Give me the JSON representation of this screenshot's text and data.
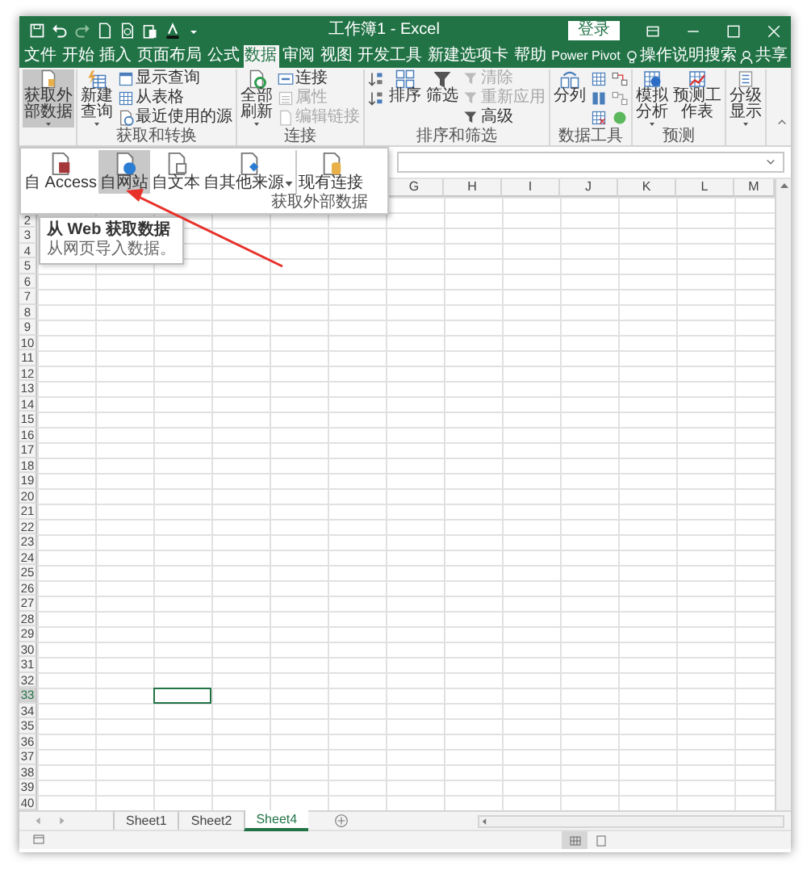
{
  "window": {
    "title": "工作簿1 - Excel"
  },
  "sign_in_button": "登录",
  "tabs": [
    {
      "label": "文件",
      "selected": false
    },
    {
      "label": "开始",
      "selected": false
    },
    {
      "label": "插入",
      "selected": false
    },
    {
      "label": "页面布局",
      "selected": false
    },
    {
      "label": "公式",
      "selected": false
    },
    {
      "label": "数据",
      "selected": true
    },
    {
      "label": "审阅",
      "selected": false
    },
    {
      "label": "视图",
      "selected": false
    },
    {
      "label": "开发工具",
      "selected": false
    },
    {
      "label": "新建选项卡",
      "selected": false
    },
    {
      "label": "帮助",
      "selected": false
    },
    {
      "label": "Power Pivot",
      "selected": false
    }
  ],
  "tell_me": "操作说明搜索",
  "share": "共享",
  "ribbon_groups": [
    {
      "items": [
        {
          "kind": "large",
          "label": "获取外部数据",
          "dropdown": true,
          "pressed": true
        }
      ]
    },
    {
      "label": "获取和转换",
      "items": [
        {
          "kind": "large",
          "label": "新建查询",
          "dropdown": true,
          "pressed": false
        },
        {
          "kind": "small",
          "label": "显示查询",
          "disabled": false
        },
        {
          "kind": "small",
          "label": "从表格",
          "disabled": false
        },
        {
          "kind": "small",
          "label": "最近使用的源",
          "disabled": false
        }
      ]
    },
    {
      "label": "连接",
      "items": [
        {
          "kind": "large",
          "label": "全部刷新",
          "dropdown": true,
          "pressed": false
        },
        {
          "kind": "small",
          "label": "连接",
          "disabled": false
        },
        {
          "kind": "small",
          "label": "属性",
          "disabled": true
        },
        {
          "kind": "small",
          "label": "编辑链接",
          "disabled": true
        }
      ]
    },
    {
      "label": "排序和筛选",
      "items": [
        {
          "kind": "icon"
        },
        {
          "kind": "icon"
        },
        {
          "kind": "large",
          "label": "排序",
          "dropdown": false,
          "pressed": false
        },
        {
          "kind": "large",
          "label": "筛选",
          "dropdown": false,
          "pressed": false
        },
        {
          "kind": "small",
          "label": "清除",
          "disabled": true
        },
        {
          "kind": "small",
          "label": "重新应用",
          "disabled": true
        },
        {
          "kind": "small",
          "label": "高级",
          "disabled": false
        }
      ]
    },
    {
      "label": "数据工具",
      "items": [
        {
          "kind": "large",
          "label": "分列",
          "dropdown": false,
          "pressed": false
        },
        {
          "kind": "icon"
        },
        {
          "kind": "icon"
        },
        {
          "kind": "icon"
        },
        {
          "kind": "icon"
        },
        {
          "kind": "icon"
        },
        {
          "kind": "icon"
        }
      ]
    },
    {
      "label": "预测",
      "items": [
        {
          "kind": "large",
          "label": "模拟分析",
          "dropdown": true,
          "pressed": false
        },
        {
          "kind": "large",
          "label": "预测工作表",
          "dropdown": false,
          "pressed": false
        }
      ]
    },
    {
      "items": [
        {
          "kind": "large",
          "label": "分级显示",
          "dropdown": true,
          "pressed": false
        }
      ]
    }
  ],
  "dropdown": {
    "items": [
      {
        "label": "自 Access",
        "selected": false,
        "dropdown": false
      },
      {
        "label": "自网站",
        "selected": true,
        "dropdown": false
      },
      {
        "label": "自文本",
        "selected": false,
        "dropdown": false
      },
      {
        "label": "自其他来源",
        "selected": false,
        "dropdown": true
      },
      {
        "label": "现有连接",
        "selected": false,
        "dropdown": false
      }
    ],
    "label": "获取外部数据"
  },
  "tooltip": {
    "title": "从 Web 获取数据",
    "text": "从网页导入数据。"
  },
  "column_headers": [
    "G",
    "H",
    "I",
    "J",
    "K",
    "L",
    "M"
  ],
  "rows": [
    {
      "label": "2",
      "selected": false
    },
    {
      "label": "3",
      "selected": false
    },
    {
      "label": "4",
      "selected": false
    },
    {
      "label": "5",
      "selected": false
    },
    {
      "label": "6",
      "selected": false
    },
    {
      "label": "7",
      "selected": false
    },
    {
      "label": "8",
      "selected": false
    },
    {
      "label": "9",
      "selected": false
    },
    {
      "label": "10",
      "selected": false
    },
    {
      "label": "11",
      "selected": false
    },
    {
      "label": "12",
      "selected": false
    },
    {
      "label": "13",
      "selected": false
    },
    {
      "label": "14",
      "selected": false
    },
    {
      "label": "15",
      "selected": false
    },
    {
      "label": "16",
      "selected": false
    },
    {
      "label": "17",
      "selected": false
    },
    {
      "label": "18",
      "selected": false
    },
    {
      "label": "19",
      "selected": false
    },
    {
      "label": "20",
      "selected": false
    },
    {
      "label": "21",
      "selected": false
    },
    {
      "label": "22",
      "selected": false
    },
    {
      "label": "23",
      "selected": false
    },
    {
      "label": "24",
      "selected": false
    },
    {
      "label": "25",
      "selected": false
    },
    {
      "label": "26",
      "selected": false
    },
    {
      "label": "27",
      "selected": false
    },
    {
      "label": "28",
      "selected": false
    },
    {
      "label": "29",
      "selected": false
    },
    {
      "label": "30",
      "selected": false
    },
    {
      "label": "31",
      "selected": false
    },
    {
      "label": "32",
      "selected": false
    },
    {
      "label": "33",
      "selected": true
    },
    {
      "label": "34",
      "selected": false
    },
    {
      "label": "35",
      "selected": false
    },
    {
      "label": "36",
      "selected": false
    },
    {
      "label": "37",
      "selected": false
    },
    {
      "label": "38",
      "selected": false
    },
    {
      "label": "39",
      "selected": false
    },
    {
      "label": "40",
      "selected": false
    }
  ],
  "sheet_tabs": [
    {
      "label": "Sheet1",
      "selected": false
    },
    {
      "label": "Sheet2",
      "selected": false
    },
    {
      "label": "Sheet4",
      "selected": true
    }
  ]
}
